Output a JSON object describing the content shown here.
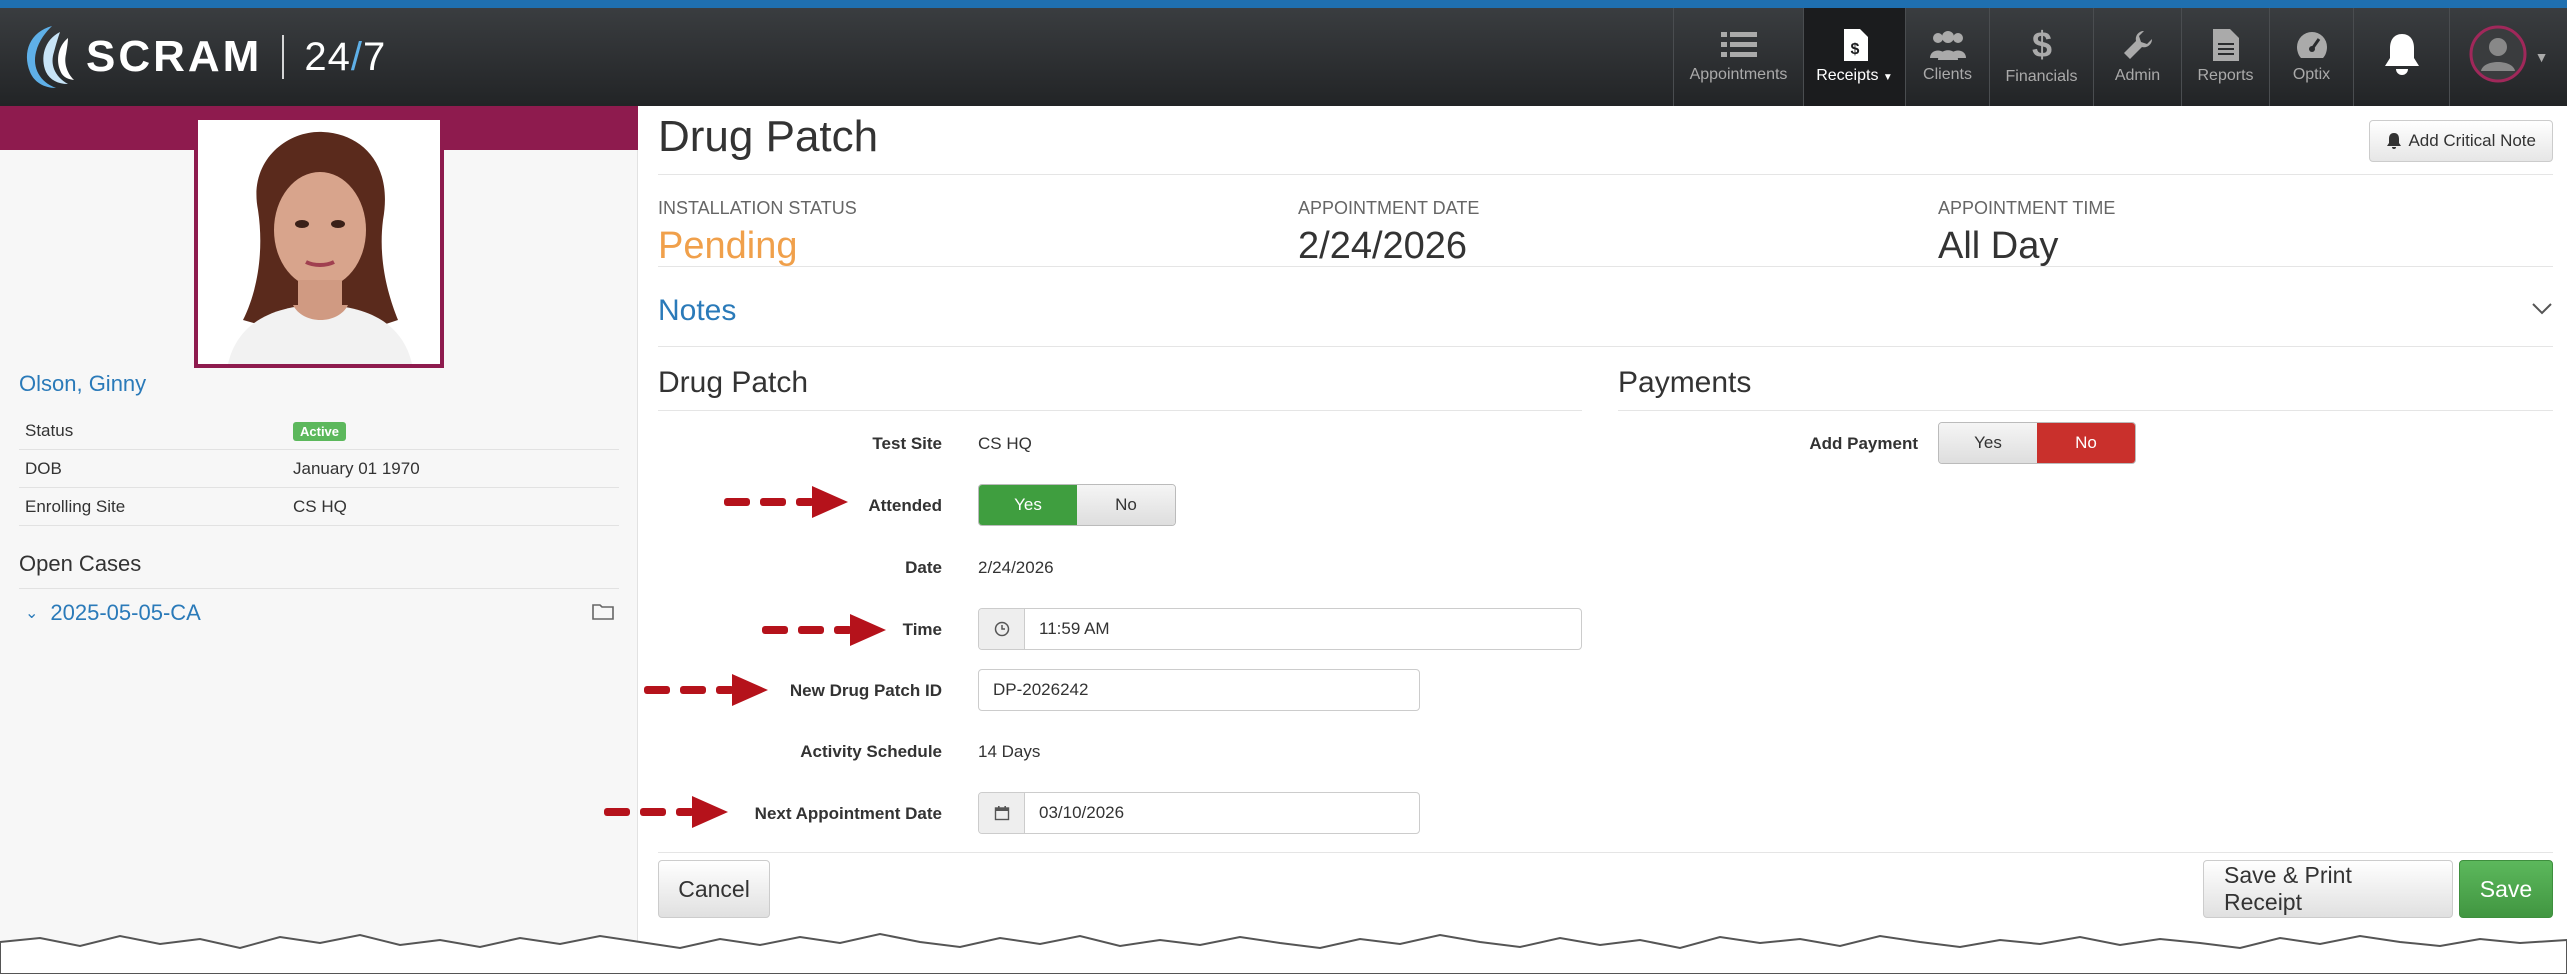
{
  "brand": {
    "name": "SCRAM",
    "suffix_a": "24",
    "suffix_slash": "/",
    "suffix_b": "7"
  },
  "nav": {
    "items": [
      {
        "label": "Appointments",
        "icon": "list-icon"
      },
      {
        "label": "Receipts",
        "icon": "receipt-icon",
        "active": true
      },
      {
        "label": "Clients",
        "icon": "users-icon"
      },
      {
        "label": "Financials",
        "icon": "dollar-icon"
      },
      {
        "label": "Admin",
        "icon": "wrench-icon"
      },
      {
        "label": "Reports",
        "icon": "document-icon"
      },
      {
        "label": "Optix",
        "icon": "dashboard-icon"
      }
    ],
    "notifications_icon": "bell-icon",
    "user_icon": "user-avatar-icon"
  },
  "client": {
    "name": "Olson, Ginny",
    "fields": [
      {
        "label": "Status",
        "value": "Active",
        "badge": true
      },
      {
        "label": "DOB",
        "value": "January 01 1970"
      },
      {
        "label": "Enrolling Site",
        "value": "CS HQ"
      }
    ],
    "open_cases_title": "Open Cases",
    "cases": [
      "2025-05-05-CA"
    ]
  },
  "page": {
    "title": "Drug Patch",
    "critical_note_label": "Add Critical Note",
    "summary": {
      "installation_status_label": "INSTALLATION STATUS",
      "installation_status_value": "Pending",
      "appointment_date_label": "APPOINTMENT DATE",
      "appointment_date_value": "2/24/2026",
      "appointment_time_label": "APPOINTMENT TIME",
      "appointment_time_value": "All Day"
    },
    "notes_label": "Notes"
  },
  "drug_patch": {
    "section_title": "Drug Patch",
    "test_site_label": "Test Site",
    "test_site_value": "CS HQ",
    "attended_label": "Attended",
    "attended_yes": "Yes",
    "attended_no": "No",
    "date_label": "Date",
    "date_value": "2/24/2026",
    "time_label": "Time",
    "time_value": "11:59 AM",
    "new_id_label": "New Drug Patch ID",
    "new_id_value": "DP-2026242",
    "schedule_label": "Activity Schedule",
    "schedule_value": "14 Days",
    "next_appt_label": "Next Appointment Date",
    "next_appt_value": "03/10/2026"
  },
  "payments": {
    "section_title": "Payments",
    "add_payment_label": "Add Payment",
    "yes": "Yes",
    "no": "No"
  },
  "actions": {
    "cancel": "Cancel",
    "save_print": "Save & Print Receipt",
    "save": "Save"
  },
  "colors": {
    "brand_magenta": "#8e1b4e",
    "link_blue": "#2a7ab9",
    "pending_orange": "#f0a04b",
    "success_green": "#3f9e3f",
    "danger_red": "#c9302c",
    "annotation_arrow": "#b5121b"
  }
}
